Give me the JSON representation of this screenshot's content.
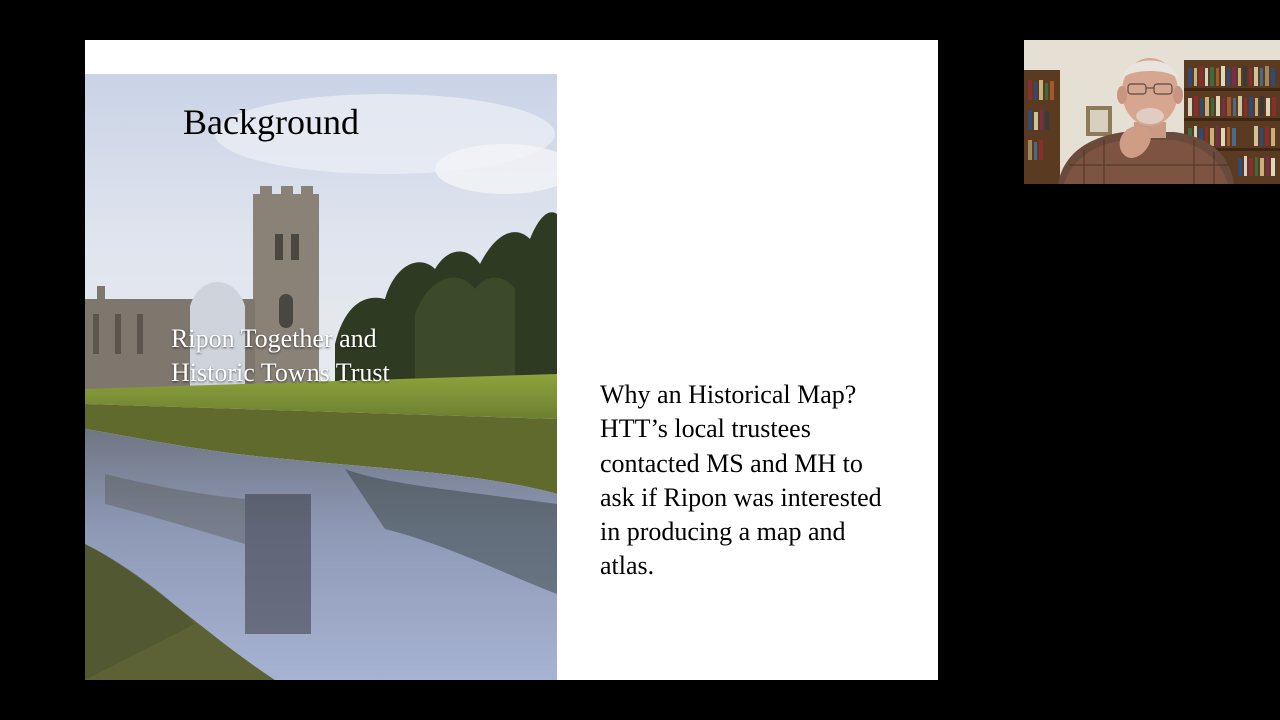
{
  "slide": {
    "title": "Background",
    "subtitle_lines": [
      "Ripon Together and",
      "Historic Towns Trust"
    ],
    "body_lines": [
      "Why an Historical Map?",
      "HTT’s local trustees",
      "contacted MS and MH to",
      "ask if Ripon was interested",
      "in producing a map and",
      "atlas."
    ]
  },
  "icons": {
    "photo": "abbey-ruins-river-photo",
    "webcam": "presenter-webcam-video"
  }
}
